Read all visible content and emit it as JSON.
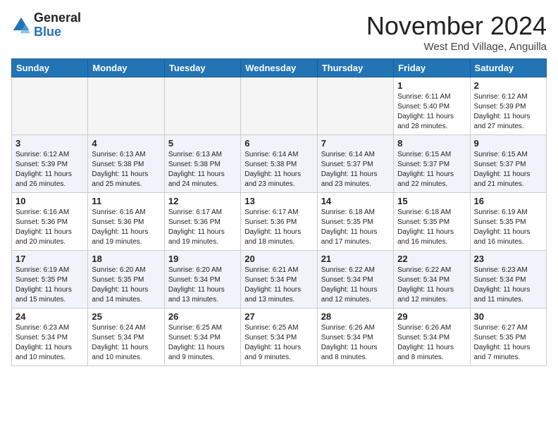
{
  "header": {
    "logo_general": "General",
    "logo_blue": "Blue",
    "month_title": "November 2024",
    "location": "West End Village, Anguilla"
  },
  "days_of_week": [
    "Sunday",
    "Monday",
    "Tuesday",
    "Wednesday",
    "Thursday",
    "Friday",
    "Saturday"
  ],
  "weeks": [
    [
      {
        "day": "",
        "info": ""
      },
      {
        "day": "",
        "info": ""
      },
      {
        "day": "",
        "info": ""
      },
      {
        "day": "",
        "info": ""
      },
      {
        "day": "",
        "info": ""
      },
      {
        "day": "1",
        "info": "Sunrise: 6:11 AM\nSunset: 5:40 PM\nDaylight: 11 hours\nand 28 minutes."
      },
      {
        "day": "2",
        "info": "Sunrise: 6:12 AM\nSunset: 5:39 PM\nDaylight: 11 hours\nand 27 minutes."
      }
    ],
    [
      {
        "day": "3",
        "info": "Sunrise: 6:12 AM\nSunset: 5:39 PM\nDaylight: 11 hours\nand 26 minutes."
      },
      {
        "day": "4",
        "info": "Sunrise: 6:13 AM\nSunset: 5:38 PM\nDaylight: 11 hours\nand 25 minutes."
      },
      {
        "day": "5",
        "info": "Sunrise: 6:13 AM\nSunset: 5:38 PM\nDaylight: 11 hours\nand 24 minutes."
      },
      {
        "day": "6",
        "info": "Sunrise: 6:14 AM\nSunset: 5:38 PM\nDaylight: 11 hours\nand 23 minutes."
      },
      {
        "day": "7",
        "info": "Sunrise: 6:14 AM\nSunset: 5:37 PM\nDaylight: 11 hours\nand 23 minutes."
      },
      {
        "day": "8",
        "info": "Sunrise: 6:15 AM\nSunset: 5:37 PM\nDaylight: 11 hours\nand 22 minutes."
      },
      {
        "day": "9",
        "info": "Sunrise: 6:15 AM\nSunset: 5:37 PM\nDaylight: 11 hours\nand 21 minutes."
      }
    ],
    [
      {
        "day": "10",
        "info": "Sunrise: 6:16 AM\nSunset: 5:36 PM\nDaylight: 11 hours\nand 20 minutes."
      },
      {
        "day": "11",
        "info": "Sunrise: 6:16 AM\nSunset: 5:36 PM\nDaylight: 11 hours\nand 19 minutes."
      },
      {
        "day": "12",
        "info": "Sunrise: 6:17 AM\nSunset: 5:36 PM\nDaylight: 11 hours\nand 19 minutes."
      },
      {
        "day": "13",
        "info": "Sunrise: 6:17 AM\nSunset: 5:36 PM\nDaylight: 11 hours\nand 18 minutes."
      },
      {
        "day": "14",
        "info": "Sunrise: 6:18 AM\nSunset: 5:35 PM\nDaylight: 11 hours\nand 17 minutes."
      },
      {
        "day": "15",
        "info": "Sunrise: 6:18 AM\nSunset: 5:35 PM\nDaylight: 11 hours\nand 16 minutes."
      },
      {
        "day": "16",
        "info": "Sunrise: 6:19 AM\nSunset: 5:35 PM\nDaylight: 11 hours\nand 16 minutes."
      }
    ],
    [
      {
        "day": "17",
        "info": "Sunrise: 6:19 AM\nSunset: 5:35 PM\nDaylight: 11 hours\nand 15 minutes."
      },
      {
        "day": "18",
        "info": "Sunrise: 6:20 AM\nSunset: 5:35 PM\nDaylight: 11 hours\nand 14 minutes."
      },
      {
        "day": "19",
        "info": "Sunrise: 6:20 AM\nSunset: 5:34 PM\nDaylight: 11 hours\nand 13 minutes."
      },
      {
        "day": "20",
        "info": "Sunrise: 6:21 AM\nSunset: 5:34 PM\nDaylight: 11 hours\nand 13 minutes."
      },
      {
        "day": "21",
        "info": "Sunrise: 6:22 AM\nSunset: 5:34 PM\nDaylight: 11 hours\nand 12 minutes."
      },
      {
        "day": "22",
        "info": "Sunrise: 6:22 AM\nSunset: 5:34 PM\nDaylight: 11 hours\nand 12 minutes."
      },
      {
        "day": "23",
        "info": "Sunrise: 6:23 AM\nSunset: 5:34 PM\nDaylight: 11 hours\nand 11 minutes."
      }
    ],
    [
      {
        "day": "24",
        "info": "Sunrise: 6:23 AM\nSunset: 5:34 PM\nDaylight: 11 hours\nand 10 minutes."
      },
      {
        "day": "25",
        "info": "Sunrise: 6:24 AM\nSunset: 5:34 PM\nDaylight: 11 hours\nand 10 minutes."
      },
      {
        "day": "26",
        "info": "Sunrise: 6:25 AM\nSunset: 5:34 PM\nDaylight: 11 hours\nand 9 minutes."
      },
      {
        "day": "27",
        "info": "Sunrise: 6:25 AM\nSunset: 5:34 PM\nDaylight: 11 hours\nand 9 minutes."
      },
      {
        "day": "28",
        "info": "Sunrise: 6:26 AM\nSunset: 5:34 PM\nDaylight: 11 hours\nand 8 minutes."
      },
      {
        "day": "29",
        "info": "Sunrise: 6:26 AM\nSunset: 5:34 PM\nDaylight: 11 hours\nand 8 minutes."
      },
      {
        "day": "30",
        "info": "Sunrise: 6:27 AM\nSunset: 5:35 PM\nDaylight: 11 hours\nand 7 minutes."
      }
    ]
  ]
}
